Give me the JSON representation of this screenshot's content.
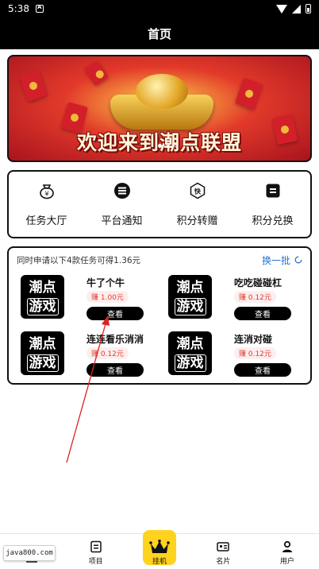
{
  "status_bar": {
    "time": "5:38"
  },
  "header": {
    "title": "首页"
  },
  "banner": {
    "text": "欢迎来到潮点联盟"
  },
  "menu": {
    "items": [
      {
        "label": "任务大厅",
        "icon": "money-bag-icon"
      },
      {
        "label": "平台通知",
        "icon": "list-icon"
      },
      {
        "label": "积分转赠",
        "icon": "transfer-icon"
      },
      {
        "label": "积分兑换",
        "icon": "exchange-icon"
      }
    ]
  },
  "tasks": {
    "tip": "同时申请以下4款任务可得1.36元",
    "refresh_label": "换一批",
    "items": [
      {
        "logo_line1": "潮点",
        "logo_line2": "游戏",
        "name": "牛了个牛",
        "reward": "赚 1.00元",
        "button": "查看"
      },
      {
        "logo_line1": "潮点",
        "logo_line2": "游戏",
        "name": "吃吃碰碰杠",
        "reward": "赚 0.12元",
        "button": "查看"
      },
      {
        "logo_line1": "潮点",
        "logo_line2": "游戏",
        "name": "连连看乐消消",
        "reward": "赚 0.12元",
        "button": "查看"
      },
      {
        "logo_line1": "潮点",
        "logo_line2": "游戏",
        "name": "连消对碰",
        "reward": "赚 0.12元",
        "button": "查看"
      }
    ]
  },
  "tab_bar": {
    "items": [
      {
        "label": "",
        "icon": "home-icon"
      },
      {
        "label": "项目",
        "icon": "project-icon"
      },
      {
        "label": "挂机",
        "icon": "crown-icon"
      },
      {
        "label": "名片",
        "icon": "card-icon"
      },
      {
        "label": "用户",
        "icon": "user-icon"
      }
    ]
  },
  "watermark": {
    "text": "java800.com"
  },
  "colors": {
    "accent_blue": "#2a74d8",
    "reward_red": "#e23a2a",
    "crown_yellow": "#ffd21f"
  }
}
